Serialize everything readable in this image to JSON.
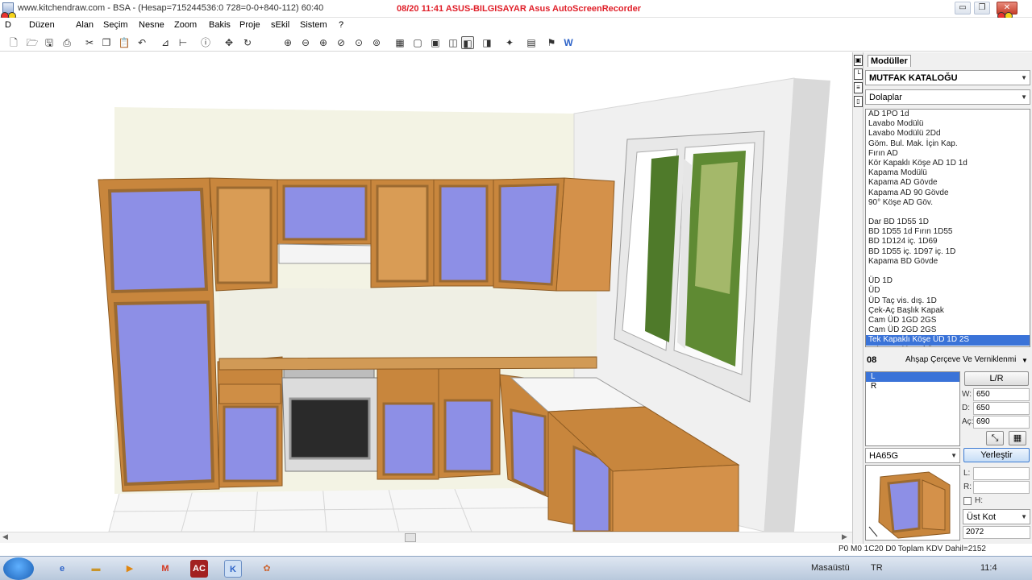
{
  "window": {
    "title": "www.kitchendraw.com - BSA - (Hesap=715244536:0 728=0-0+840-112) 60:40",
    "recorder_text": "08/20  11:41  ASUS-BILGISAYAR  Asus  AutoScreenRecorder",
    "minimize": "▭",
    "maximize": "❐",
    "close": "✕"
  },
  "menu": [
    "D",
    "Düzen",
    "Alan",
    "Seçim",
    "Nesne",
    "Zoom",
    "Bakis",
    "Proje",
    "sEkil",
    "Sistem",
    "?"
  ],
  "colors": {
    "selection": "#3a73d8",
    "cabinet_wood": "#c8863d",
    "cabinet_door": "#8d8fe6",
    "wall": "#f2f2e6",
    "recorder_red": "#e0202a"
  },
  "toolbar_icons": [
    "new-icon",
    "open-icon",
    "save-icon",
    "print-icon",
    "cut-icon",
    "copy-icon",
    "paste-icon",
    "undo-icon",
    "measure-icon",
    "dimension-icon",
    "info-icon",
    "move-icon",
    "rotate-icon",
    "zoom-in-icon",
    "zoom-out-icon",
    "zoom-window-icon",
    "zoom-all-icon",
    "zoom-prev-icon",
    "zoom-next-icon",
    "plan-view-icon",
    "elevation-view-icon",
    "box-view-icon",
    "3d-view-icon",
    "perspective-view-icon",
    "render-icon",
    "light-icon",
    "material-icon",
    "flag-icon",
    "w-icon"
  ],
  "panel": {
    "tab_label": "Modüller",
    "catalog": "MUTFAK KATALOĞU",
    "category": "Dolaplar",
    "items": [
      "AD 1PO 1d",
      "Lavabo Modülü",
      "Lavabo Modülü 2Dd",
      "Göm. Bul. Mak. İçin Kap.",
      "Fırın AD",
      "Kör Kapaklı Köşe AD 1D 1d",
      "Kapama Modülü",
      "Kapama AD Gövde",
      "Kapama AD 90 Gövde",
      "90° Köşe AD Göv.",
      "",
      "Dar BD 1D55 1D",
      "BD 1D55 1d Fırın 1D55",
      "BD 1D124 iç. 1D69",
      "BD 1D55 iç. 1D97 iç. 1D",
      "Kapama BD Gövde",
      "",
      "ÜD 1D",
      "ÜD",
      "ÜD Taç vis. dış. 1D",
      "Çek-Aç Başlık Kapak",
      "Cam ÜD 1GD 2GS",
      "Cam ÜD 2GD 2GS",
      "Tek Kapaklı Köşe ÜD 1D 2S",
      "Tek Kapaklı Raf ÜD 1S"
    ],
    "selected_item_index": 23,
    "finish_code": "08",
    "finish_name": "Ahşap Çerçeve Ve Verniklenmi",
    "hinge_options": [
      "L",
      "R"
    ],
    "selected_hinge_index": 0,
    "lr_button": "L/R",
    "width_label": "W:",
    "width_value": "650",
    "depth_label": "D:",
    "depth_value": "650",
    "height_label": "Aç:",
    "height_value": "690",
    "model_code": "HA65G",
    "place_button": "Yerleştir",
    "l_label": "L:",
    "r_label": "R:",
    "h_label": "H:",
    "kot_option": "Üst Kot",
    "kot_value": "2072"
  },
  "status": {
    "text": "P0 M0 1C20 D0 Toplam KDV Dahil=2152"
  },
  "taskbar": {
    "desktop_label": "Masaüstü",
    "lang": "TR",
    "clock": "11:4",
    "apps": [
      "ie-icon",
      "folder-icon",
      "media-icon",
      "office-icon",
      "autocad-icon",
      "kitchendraw-icon",
      "paint-icon"
    ]
  }
}
